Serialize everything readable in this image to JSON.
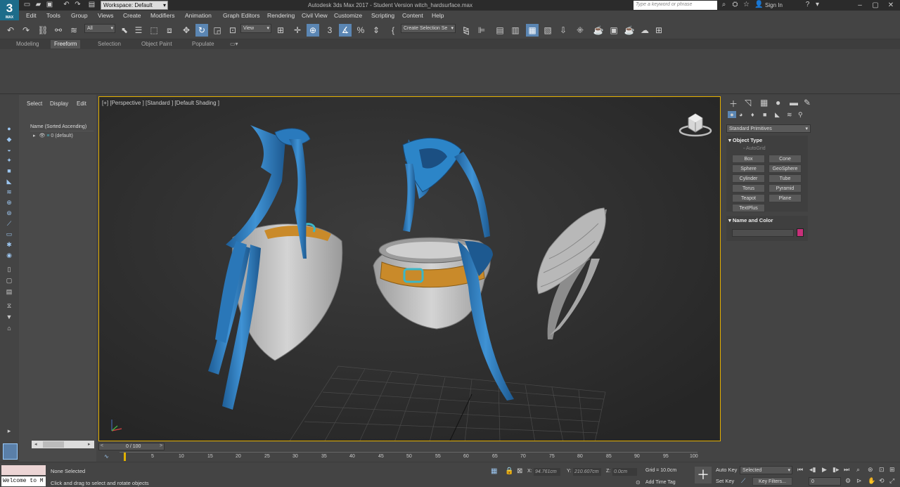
{
  "app": {
    "logo_text": "3",
    "logo_sub": "MAX",
    "title": "Autodesk 3ds Max 2017  - Student Version   witch_hardsurface.max"
  },
  "workspace": {
    "label": "Workspace: Default"
  },
  "search": {
    "placeholder": "Type a keyword or phrase"
  },
  "account": {
    "signin": "Sign In"
  },
  "menus": [
    "Edit",
    "Tools",
    "Group",
    "Views",
    "Create",
    "Modifiers",
    "Animation",
    "Graph Editors",
    "Rendering",
    "Civil View",
    "Customize",
    "Scripting",
    "Content",
    "Help"
  ],
  "toolbar": {
    "filter": "All",
    "ref_coord": "View",
    "selection_set": "Create Selection Se"
  },
  "ribbon": {
    "tabs": [
      "Modeling",
      "Freeform",
      "Selection",
      "Object Paint",
      "Populate"
    ],
    "active": "Freeform"
  },
  "scene_explorer": {
    "tabs": [
      "Select",
      "Display",
      "Edit"
    ],
    "column_header": "Name (Sorted Ascending)",
    "layer": "0 (default)"
  },
  "viewport": {
    "label": "[+] [Perspective ] [Standard ] [Default Shading ]"
  },
  "command_panel": {
    "dropdown": "Standard Primitives",
    "rollout_object_type": "Object Type",
    "autogrid": "AutoGrid",
    "primitives": [
      "Box",
      "Cone",
      "Sphere",
      "GeoSphere",
      "Cylinder",
      "Tube",
      "Torus",
      "Pyramid",
      "Teapot",
      "Plane",
      "TextPlus"
    ],
    "rollout_name_color": "Name and Color",
    "color_swatch": "#c8307a"
  },
  "timeline": {
    "frame": "0 / 100",
    "ticks": [
      "5",
      "10",
      "15",
      "20",
      "25",
      "30",
      "35",
      "40",
      "45",
      "50",
      "55",
      "60",
      "65",
      "70",
      "75",
      "80",
      "85",
      "90",
      "95",
      "100"
    ]
  },
  "status": {
    "maxscript": "Welcome to M",
    "selected": "None Selected",
    "prompt": "Click and drag to select and rotate objects",
    "x_label": "X:",
    "x_value": "94.761cm",
    "y_label": "Y:",
    "y_value": "210.607cm",
    "z_label": "Z:",
    "z_value": "0.0cm",
    "grid": "Grid = 10.0cm",
    "add_time_tag": "Add Time Tag",
    "auto_key": "Auto Key",
    "set_key": "Set Key",
    "key_mode": "Selected",
    "key_filters": "Key Filters...",
    "frame_field": "0"
  }
}
